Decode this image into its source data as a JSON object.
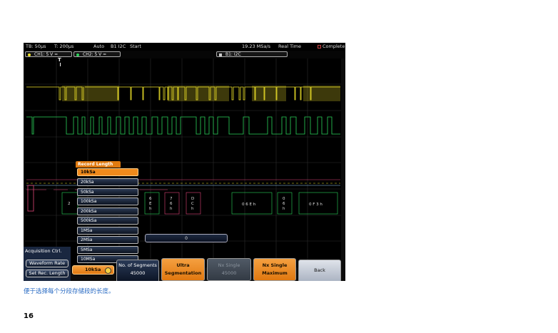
{
  "status": {
    "timebase": "TB: 50µs",
    "trigger_time": "T: 200µs",
    "mode": "Auto",
    "trigger_source": "B1 I2C",
    "trigger_state": "Start",
    "sample_rate": "19.23 MSa/s",
    "acq_mode": "Real Time",
    "completion": "Complete"
  },
  "channels": [
    {
      "label": "CH1: 5 V =",
      "color": "#f2e52a"
    },
    {
      "label": "CH2: 5 V =",
      "color": "#2bd45a"
    },
    {
      "label": "B1: I2C",
      "color": "#cccccc"
    }
  ],
  "trigger_marker": "T",
  "record_length_menu": {
    "title": "Record Length",
    "items": [
      "10kSa",
      "20kSa",
      "50kSa",
      "100kSa",
      "200kSa",
      "500kSa",
      "1MSa",
      "2MSa",
      "5MSa",
      "10MSa"
    ],
    "selected": "10kSa"
  },
  "bus_decode": {
    "labels": [
      "2",
      "6\nE\nh",
      "7\n6\nh",
      "D\nC\nh",
      "0 6 E h",
      "0\n6\nh",
      "0 F 3 h"
    ]
  },
  "segment_slider": {
    "value": "0"
  },
  "acquisition_panel": {
    "title": "Acquisition Ctrl.",
    "waveform_rate": "Waveform Rate",
    "set_rec_length": "Set Rec. Length"
  },
  "softkeys": {
    "rec_length_value": "10kSa",
    "segments_title": "No. of Segments",
    "segments_value": "45000",
    "ultra_line1": "Ultra",
    "ultra_line2": "Segmentation",
    "nx_single_title": "Nx Single",
    "nx_single_value": "45000",
    "nx_max_line1": "Nx Single",
    "nx_max_line2": "Maximum",
    "back": "Back"
  },
  "colors": {
    "ch1": "#f2e52a",
    "ch2": "#2bd45a",
    "bus": "#e0457a",
    "accent": "#f08a1c"
  },
  "caption": "便于选择每个分段存储段的长度。",
  "page_number": "16"
}
